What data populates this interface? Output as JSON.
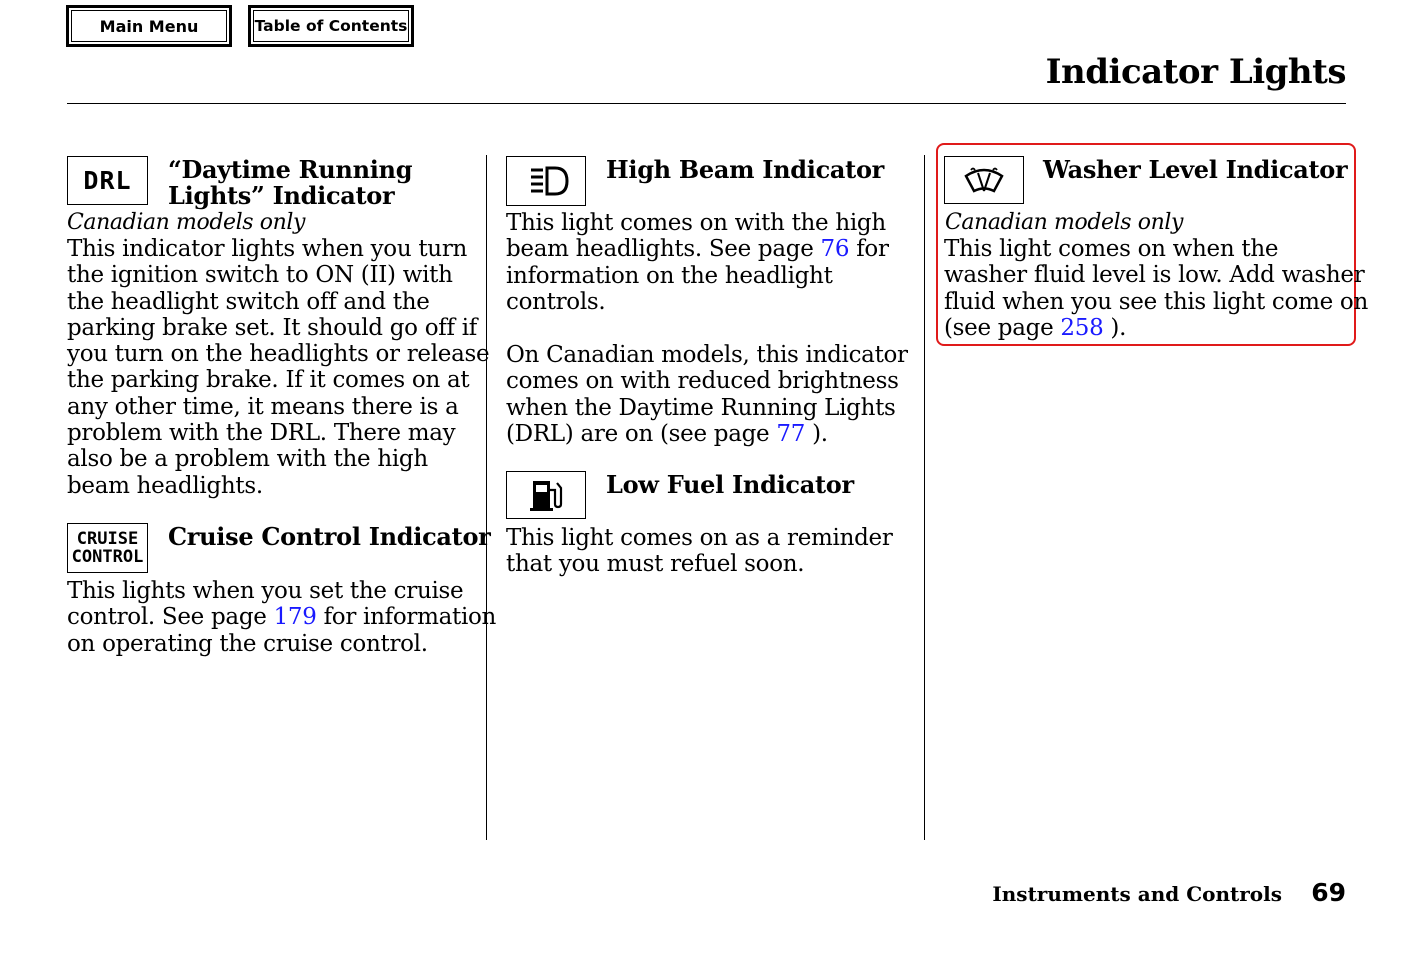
{
  "nav": {
    "main_menu": "Main Menu",
    "toc": "Table of Contents"
  },
  "page_title": "Indicator Lights",
  "sections": {
    "drl": {
      "icon_text": "DRL",
      "heading_line1": "“Daytime Running",
      "heading_line2": "Lights” Indicator",
      "note": "Canadian models only",
      "body": [
        "This indicator lights when you turn",
        "the ignition switch to ON (II) with",
        "the headlight switch off and the",
        "parking brake set. It should go off if",
        "you turn on the headlights or release",
        "the parking brake. If it comes on at",
        "any other time, it means there is a",
        "problem with the DRL. There may",
        "also be a problem with the high",
        "beam headlights."
      ]
    },
    "cruise": {
      "icon_text_line1": "CRUISE",
      "icon_text_line2": "CONTROL",
      "heading": "Cruise Control Indicator",
      "line1": "This lights when you set the cruise",
      "line2_before": "control. See page ",
      "line2_link": "179",
      "line2_after": " for information",
      "line3": "on operating the cruise control."
    },
    "high_beam": {
      "icon": "high-beam-icon",
      "heading": "High Beam Indicator",
      "line1": "This light comes on with the high",
      "line2_before": "beam headlights. See page ",
      "line2_link": "76",
      "line2_after": " for",
      "line3": "information on the headlight",
      "line4": "controls.",
      "p2_line1": "On Canadian models, this indicator",
      "p2_line2": "comes on with reduced brightness",
      "p2_line3": "when the Daytime Running Lights",
      "p2_line4_before": "(DRL) are on (see page ",
      "p2_line4_link": "77",
      "p2_line4_after": " )."
    },
    "low_fuel": {
      "icon": "fuel-pump-icon",
      "heading": "Low Fuel Indicator",
      "line1": "This light comes on as a reminder",
      "line2": "that you must refuel soon."
    },
    "washer": {
      "icon": "washer-icon",
      "heading": "Washer Level Indicator",
      "note": "Canadian models only",
      "line1": "This light comes on when the",
      "line2": "washer fluid level is low. Add washer",
      "line3": "fluid when you see this light come on",
      "line4_before": "(see page ",
      "line4_link": "258",
      "line4_after": " )."
    }
  },
  "footer": {
    "section": "Instruments and Controls",
    "page": "69"
  },
  "colors": {
    "link": "#1a1aff",
    "highlight": "#e01a1a"
  }
}
